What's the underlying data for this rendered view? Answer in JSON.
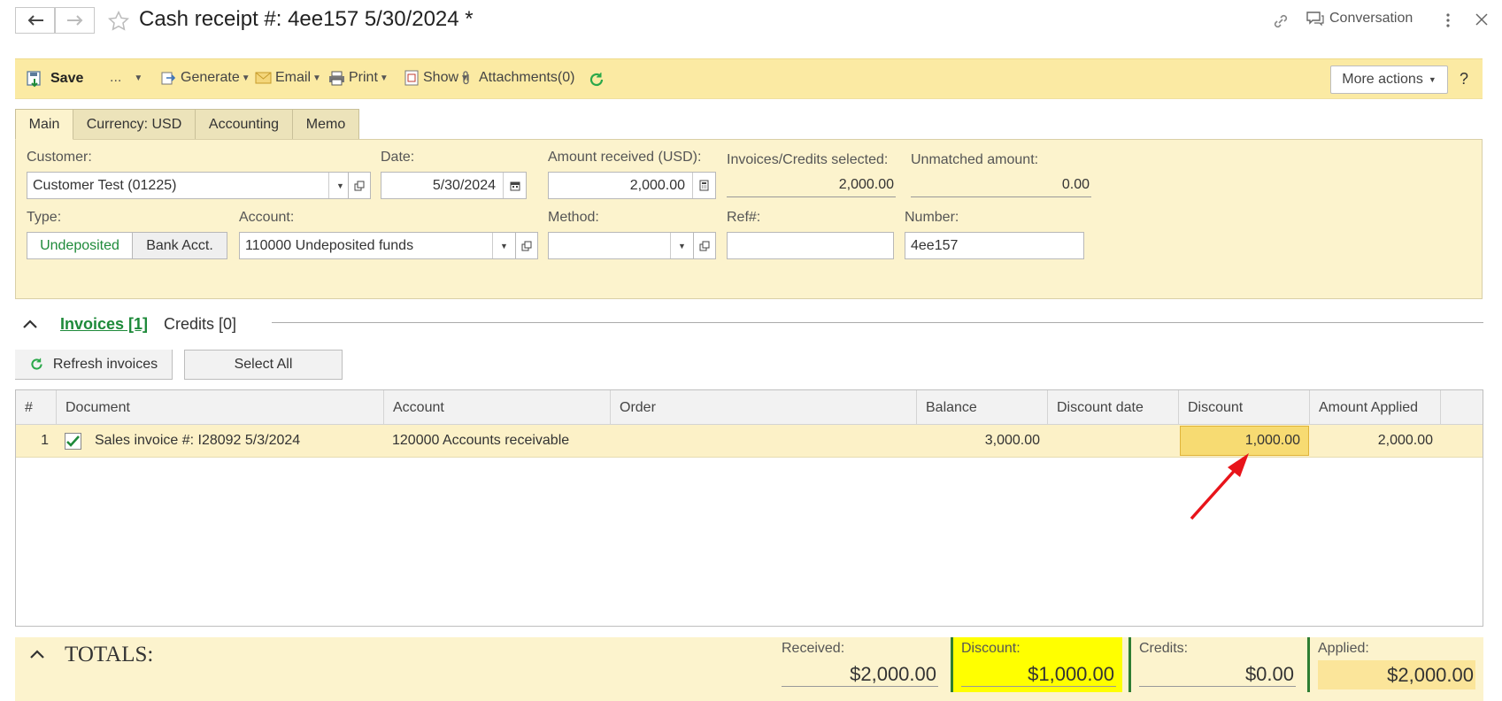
{
  "window": {
    "title": "Cash receipt #: 4ee157 5/30/2024 *",
    "conversation_label": "Conversation"
  },
  "toolbar": {
    "save": "Save",
    "more_dots": "...",
    "generate": "Generate",
    "email": "Email",
    "print": "Print",
    "show": "Show",
    "attachments": "Attachments(0)",
    "more_actions": "More actions",
    "help": "?"
  },
  "tabs": [
    "Main",
    "Currency: USD",
    "Accounting",
    "Memo"
  ],
  "form": {
    "customer_label": "Customer:",
    "customer_value": "Customer Test (01225)",
    "date_label": "Date:",
    "date_value": "5/30/2024",
    "amount_label": "Amount received (USD):",
    "amount_value": "2,000.00",
    "selected_label": "Invoices/Credits selected:",
    "selected_value": "2,000.00",
    "unmatched_label": "Unmatched amount:",
    "unmatched_value": "0.00",
    "type_label": "Type:",
    "type_options": [
      "Undeposited",
      "Bank Acct."
    ],
    "account_label": "Account:",
    "account_value": "110000 Undeposited funds",
    "method_label": "Method:",
    "method_value": "",
    "ref_label": "Ref#:",
    "ref_value": "",
    "number_label": "Number:",
    "number_value": "4ee157"
  },
  "sections": {
    "invoices_tab": "Invoices [1]",
    "credits_tab": "Credits [0]",
    "refresh_button": "Refresh invoices",
    "select_all_button": "Select All"
  },
  "table": {
    "columns": [
      "#",
      "Document",
      "Account",
      "Order",
      "Balance",
      "Discount date",
      "Discount",
      "Amount Applied"
    ],
    "rows": [
      {
        "num": "1",
        "document": "Sales invoice #: I28092 5/3/2024",
        "account": "120000 Accounts receivable",
        "order": "",
        "balance": "3,000.00",
        "discount_date": "",
        "discount": "1,000.00",
        "applied": "2,000.00",
        "checked": true
      }
    ]
  },
  "totals": {
    "title": "TOTALS:",
    "received_label": "Received:",
    "received_value": "$2,000.00",
    "discount_label": "Discount:",
    "discount_value": "$1,000.00",
    "credits_label": "Credits:",
    "credits_value": "$0.00",
    "applied_label": "Applied:",
    "applied_value": "$2,000.00"
  },
  "colors": {
    "toolbar_bg": "#fbeaa3",
    "panel_bg": "#fcf3cd",
    "link_green": "#1e8a3a",
    "highlight_yellow": "#ffff00",
    "annotation_red": "#e8141a"
  },
  "icons": [
    "back-arrow-icon",
    "forward-arrow-icon",
    "star-icon",
    "link-icon",
    "conversation-icon",
    "kebab-menu-icon",
    "close-icon",
    "save-icon",
    "generate-icon",
    "email-icon",
    "print-icon",
    "show-icon",
    "paperclip-icon",
    "refresh-icon",
    "calendar-icon",
    "calculator-icon",
    "open-form-icon",
    "chevron-up-icon",
    "checkbox-icon"
  ]
}
